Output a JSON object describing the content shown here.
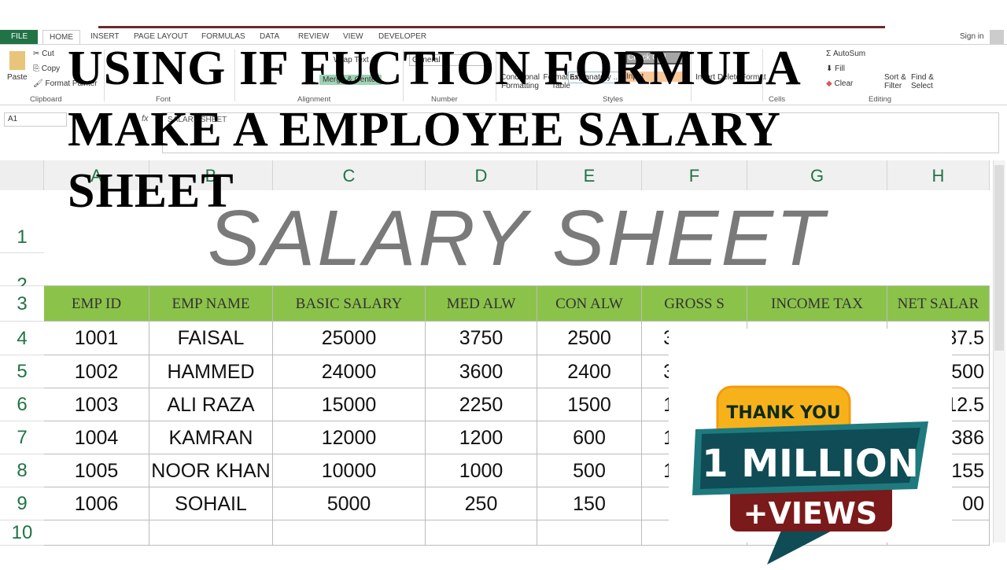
{
  "ribbon": {
    "tabs": [
      "FILE",
      "HOME",
      "INSERT",
      "PAGE LAYOUT",
      "FORMULAS",
      "DATA",
      "REVIEW",
      "VIEW",
      "DEVELOPER"
    ],
    "sign_in": "Sign in",
    "clipboard": {
      "paste": "Paste",
      "cut": "Cut",
      "copy": "Copy",
      "format_painter": "Format Painter",
      "label": "Clipboard"
    },
    "font_label": "Font",
    "alignment": {
      "wrap": "Wrap Text",
      "merge": "Merge & Center",
      "label": "Alignment"
    },
    "number": {
      "format": "General",
      "label": "Number"
    },
    "styles": {
      "conditional": "Conditional Formatting",
      "format_table": "Format as Table",
      "explanatory": "Explanatory ...",
      "check_cell": "Check Cell",
      "input": "Input",
      "label": "Styles"
    },
    "cells": {
      "insert": "Insert",
      "delete": "Delete",
      "format": "Format",
      "label": "Cells"
    },
    "editing": {
      "autosum": "AutoSum",
      "fill": "Fill",
      "clear": "Clear",
      "sort": "Sort & Filter",
      "find": "Find & Select",
      "label": "Editing"
    }
  },
  "formula_bar": {
    "name_box": "A1",
    "fx": "fx",
    "value": "SALARY SHEET"
  },
  "overlay_title": [
    "USING IF FUCTION FORMULA",
    "MAKE A EMPLOYEE SALARY",
    "SHEET"
  ],
  "columns": [
    "A",
    "B",
    "C",
    "D",
    "E",
    "F",
    "G",
    "H"
  ],
  "rows": [
    "1",
    "2",
    "3",
    "4",
    "5",
    "6",
    "7",
    "8",
    "9",
    "10"
  ],
  "sheet_title": "SALARY SHEET",
  "headers": [
    "EMP ID",
    "EMP NAME",
    "BASIC SALARY",
    "MED ALW",
    "CON ALW",
    "GROSS S",
    "INCOME TAX",
    "NET SALAR"
  ],
  "data": [
    [
      "1001",
      "FAISAL",
      "25000",
      "3750",
      "2500",
      "3",
      "",
      "87.5"
    ],
    [
      "1002",
      "HAMMED",
      "24000",
      "3600",
      "2400",
      "3",
      "",
      "500"
    ],
    [
      "1003",
      "ALI RAZA",
      "15000",
      "2250",
      "1500",
      "1",
      "",
      "12.5"
    ],
    [
      "1004",
      "KAMRAN",
      "12000",
      "1200",
      "600",
      "1",
      "",
      "386"
    ],
    [
      "1005",
      "NOOR KHAN",
      "10000",
      "1000",
      "500",
      "1",
      "",
      "155"
    ],
    [
      "1006",
      "SOHAIL",
      "5000",
      "250",
      "150",
      "",
      "",
      "00"
    ]
  ],
  "badge": {
    "thank": "THANK YOU",
    "million": "1 MILLION",
    "views": "+VIEWS",
    "colors": {
      "yellow": "#f7b21b",
      "teal": "#0f4c55",
      "red": "#7a1a1a"
    }
  },
  "colors": {
    "header_green": "#8bc34a",
    "excel_green": "#217346"
  }
}
